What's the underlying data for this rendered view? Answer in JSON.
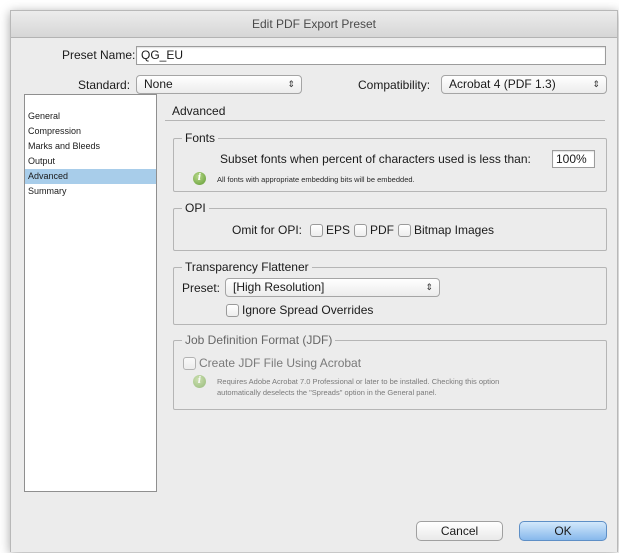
{
  "window": {
    "title": "Edit PDF Export Preset"
  },
  "preset": {
    "label": "Preset Name:",
    "value": "QG_EU"
  },
  "standard": {
    "label": "Standard:",
    "value": "None"
  },
  "compatibility": {
    "label": "Compatibility:",
    "value": "Acrobat 4 (PDF 1.3)"
  },
  "sidebar": {
    "items": [
      {
        "label": "General",
        "selected": false
      },
      {
        "label": "Compression",
        "selected": false
      },
      {
        "label": "Marks and Bleeds",
        "selected": false
      },
      {
        "label": "Output",
        "selected": false
      },
      {
        "label": "Advanced",
        "selected": true
      },
      {
        "label": "Summary",
        "selected": false
      }
    ]
  },
  "panel": {
    "heading": "Advanced",
    "fonts": {
      "title": "Fonts",
      "subset_label": "Subset fonts when percent of characters used is less than:",
      "subset_value": "100%",
      "note": "All fonts with appropriate embedding bits will be embedded."
    },
    "opi": {
      "title": "OPI",
      "omit_label": "Omit for OPI:",
      "options": [
        "EPS",
        "PDF",
        "Bitmap Images"
      ]
    },
    "flattener": {
      "title": "Transparency Flattener",
      "preset_label": "Preset:",
      "preset_value": "[High Resolution]",
      "ignore_label": "Ignore Spread Overrides"
    },
    "jdf": {
      "title": "Job Definition Format (JDF)",
      "create_label": "Create JDF File Using Acrobat",
      "note_line1": "Requires Adobe Acrobat 7.0 Professional or later to be installed. Checking this option",
      "note_line2": "automatically deselects the \"Spreads\" option in the General panel."
    }
  },
  "buttons": {
    "cancel": "Cancel",
    "ok": "OK"
  },
  "colors": {
    "selection": "#a8cdea",
    "default_button": "#87b8ec",
    "info_icon": "#5f9a32"
  }
}
